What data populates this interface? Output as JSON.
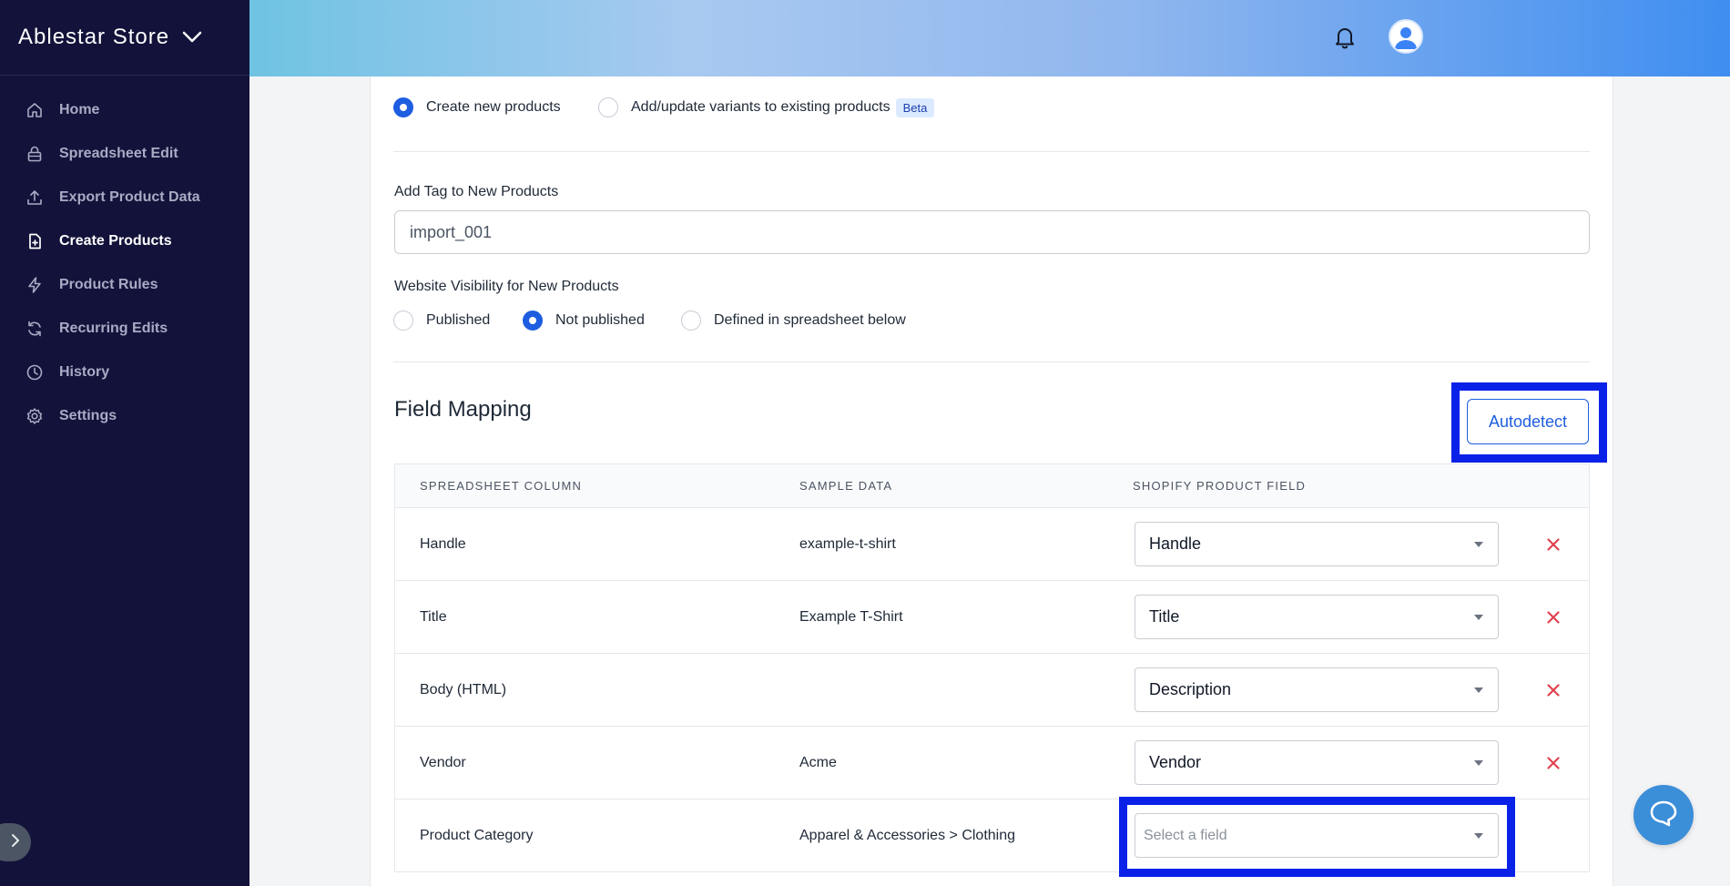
{
  "sidebar": {
    "store_name": "Ablestar Store",
    "items": [
      {
        "label": "Home",
        "icon": "home-icon"
      },
      {
        "label": "Spreadsheet Edit",
        "icon": "lock-icon"
      },
      {
        "label": "Export Product Data",
        "icon": "upload-icon"
      },
      {
        "label": "Create Products",
        "icon": "file-plus-icon",
        "active": true
      },
      {
        "label": "Product Rules",
        "icon": "bolt-icon"
      },
      {
        "label": "Recurring Edits",
        "icon": "refresh-icon"
      },
      {
        "label": "History",
        "icon": "clock-icon"
      },
      {
        "label": "Settings",
        "icon": "gear-icon"
      }
    ]
  },
  "header": {
    "icons": [
      "bell-icon",
      "avatar-icon"
    ]
  },
  "import_mode": {
    "option_new": "Create new products",
    "option_variants": "Add/update variants to existing products",
    "beta_badge": "Beta",
    "selected": "Create new products"
  },
  "tag": {
    "label": "Add Tag to New Products",
    "value": "import_001"
  },
  "visibility": {
    "label": "Website Visibility for New Products",
    "options": [
      "Published",
      "Not published",
      "Defined in spreadsheet below"
    ],
    "selected": "Not published"
  },
  "field_mapping": {
    "title": "Field Mapping",
    "autodetect_label": "Autodetect",
    "columns": [
      "SPREADSHEET COLUMN",
      "SAMPLE DATA",
      "SHOPIFY PRODUCT FIELD"
    ],
    "rows": [
      {
        "column": "Handle",
        "sample": "example-t-shirt",
        "field": "Handle",
        "removable": true
      },
      {
        "column": "Title",
        "sample": "Example T-Shirt",
        "field": "Title",
        "removable": true
      },
      {
        "column": "Body (HTML)",
        "sample": "",
        "field": "Description",
        "removable": true
      },
      {
        "column": "Vendor",
        "sample": "Acme",
        "field": "Vendor",
        "removable": true
      },
      {
        "column": "Product Category",
        "sample": "Apparel & Accessories > Clothing",
        "field": "",
        "placeholder": "Select a field",
        "removable": false
      }
    ]
  },
  "colors": {
    "sidebar_bg": "#12123a",
    "accent": "#1d5de0",
    "highlight": "#0a22e8",
    "remove": "#e0434f",
    "chat": "#3b8ed8"
  }
}
